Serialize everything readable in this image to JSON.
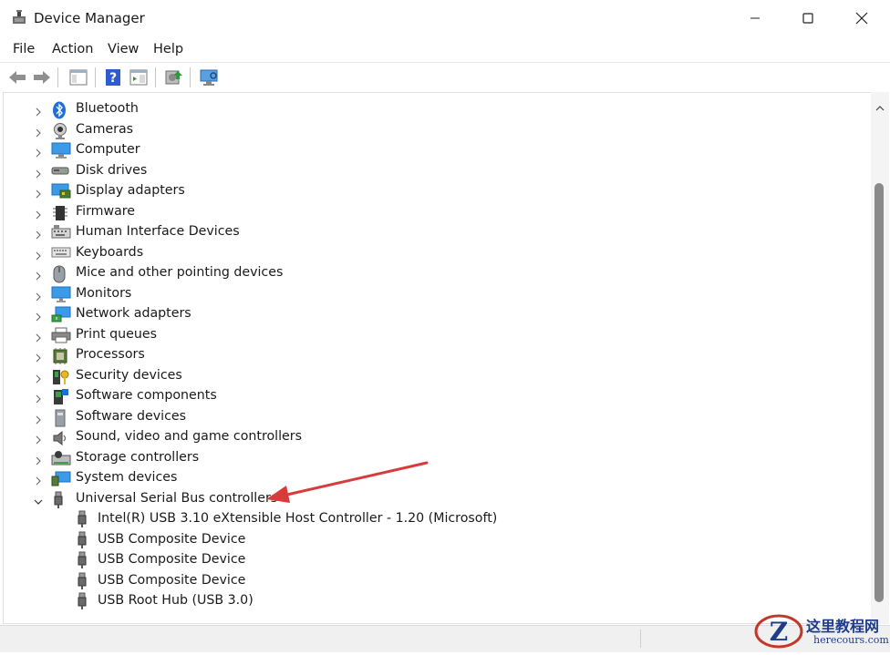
{
  "window": {
    "title": "Device Manager"
  },
  "menu": [
    "File",
    "Action",
    "View",
    "Help"
  ],
  "tree": {
    "categories": [
      {
        "label": "Bluetooth",
        "icon": "bluetooth-icon"
      },
      {
        "label": "Cameras",
        "icon": "camera-icon"
      },
      {
        "label": "Computer",
        "icon": "computer-icon"
      },
      {
        "label": "Disk drives",
        "icon": "disk-drive-icon"
      },
      {
        "label": "Display adapters",
        "icon": "display-adapter-icon"
      },
      {
        "label": "Firmware",
        "icon": "firmware-icon"
      },
      {
        "label": "Human Interface Devices",
        "icon": "hid-icon"
      },
      {
        "label": "Keyboards",
        "icon": "keyboard-icon"
      },
      {
        "label": "Mice and other pointing devices",
        "icon": "mouse-icon"
      },
      {
        "label": "Monitors",
        "icon": "monitor-icon"
      },
      {
        "label": "Network adapters",
        "icon": "network-adapter-icon"
      },
      {
        "label": "Print queues",
        "icon": "printer-icon"
      },
      {
        "label": "Processors",
        "icon": "processor-icon"
      },
      {
        "label": "Security devices",
        "icon": "security-device-icon"
      },
      {
        "label": "Software components",
        "icon": "software-component-icon"
      },
      {
        "label": "Software devices",
        "icon": "software-device-icon"
      },
      {
        "label": "Sound, video and game controllers",
        "icon": "speaker-icon"
      },
      {
        "label": "Storage controllers",
        "icon": "storage-controller-icon"
      },
      {
        "label": "System devices",
        "icon": "system-device-icon"
      },
      {
        "label": "Universal Serial Bus controllers",
        "icon": "usb-icon",
        "expanded": true
      }
    ],
    "usb_children": [
      "Intel(R) USB 3.10 eXtensible Host Controller - 1.20 (Microsoft)",
      "USB Composite Device",
      "USB Composite Device",
      "USB Composite Device",
      "USB Root Hub (USB 3.0)"
    ]
  },
  "watermark": {
    "title": "这里教程网",
    "subtitle": "herecours.com"
  },
  "colors": {
    "accent": "#1e6fd9",
    "annotation_arrow": "#d93a3a",
    "scrollbar_thumb": "#8a8a8a"
  }
}
